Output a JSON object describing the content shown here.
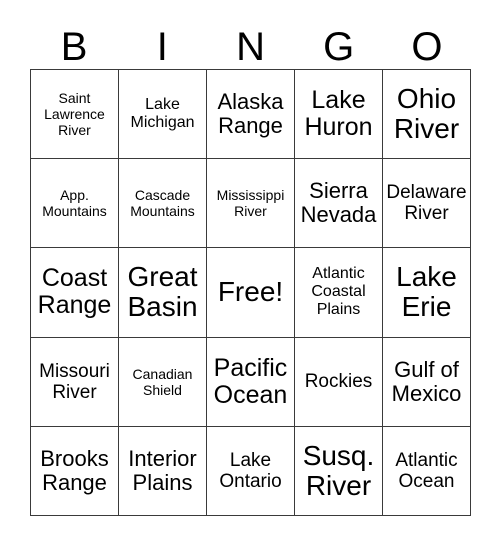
{
  "card": {
    "header_letters": [
      "B",
      "I",
      "N",
      "G",
      "O"
    ],
    "columns": 5,
    "rows": 5,
    "free_space_index": 12,
    "border_color": "#3a3a3a",
    "background_color": "#ffffff",
    "text_color": "#000000",
    "cells": [
      {
        "text": "Saint\nLawrence\nRiver",
        "size": "xs",
        "free": false
      },
      {
        "text": "Lake\nMichigan",
        "size": "sm",
        "free": false
      },
      {
        "text": "Alaska\nRange",
        "size": "lg",
        "free": false
      },
      {
        "text": "Lake\nHuron",
        "size": "xl",
        "free": false
      },
      {
        "text": "Ohio\nRiver",
        "size": "xxl",
        "free": false
      },
      {
        "text": "App.\nMountains",
        "size": "xs",
        "free": false
      },
      {
        "text": "Cascade\nMountains",
        "size": "xs",
        "free": false
      },
      {
        "text": "Mississippi\nRiver",
        "size": "xs",
        "free": false
      },
      {
        "text": "Sierra\nNevada",
        "size": "lg",
        "free": false
      },
      {
        "text": "Delaware\nRiver",
        "size": "md",
        "free": false
      },
      {
        "text": "Coast\nRange",
        "size": "xl",
        "free": false
      },
      {
        "text": "Great\nBasin",
        "size": "xxl",
        "free": false
      },
      {
        "text": "Free!",
        "size": "xxl",
        "free": true
      },
      {
        "text": "Atlantic\nCoastal\nPlains",
        "size": "sm",
        "free": false
      },
      {
        "text": "Lake\nErie",
        "size": "xxl",
        "free": false
      },
      {
        "text": "Missouri\nRiver",
        "size": "md",
        "free": false
      },
      {
        "text": "Canadian\nShield",
        "size": "xs",
        "free": false
      },
      {
        "text": "Pacific\nOcean",
        "size": "xl",
        "free": false
      },
      {
        "text": "Rockies",
        "size": "md",
        "free": false
      },
      {
        "text": "Gulf of\nMexico",
        "size": "lg",
        "free": false
      },
      {
        "text": "Brooks\nRange",
        "size": "lg",
        "free": false
      },
      {
        "text": "Interior\nPlains",
        "size": "lg",
        "free": false
      },
      {
        "text": "Lake\nOntario",
        "size": "md",
        "free": false
      },
      {
        "text": "Susq.\nRiver",
        "size": "xxl",
        "free": false
      },
      {
        "text": "Atlantic\nOcean",
        "size": "md",
        "free": false
      }
    ]
  }
}
